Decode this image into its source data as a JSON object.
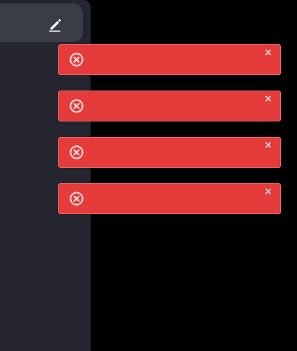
{
  "colors": {
    "background": "#000000",
    "sidebar": "#252530",
    "top_bar": "#3a3d46",
    "toast_background": "#e53b3b",
    "toast_border": "#f16c6c",
    "icon": "#f3d7d7",
    "edit_icon": "#f4f4f6"
  },
  "header": {
    "edit_icon": "pencil-icon"
  },
  "toasts": [
    {
      "icon": "x-circle-icon",
      "close_label": "×"
    },
    {
      "icon": "x-circle-icon",
      "close_label": "×"
    },
    {
      "icon": "x-circle-icon",
      "close_label": "×"
    },
    {
      "icon": "x-circle-icon",
      "close_label": "×"
    }
  ]
}
